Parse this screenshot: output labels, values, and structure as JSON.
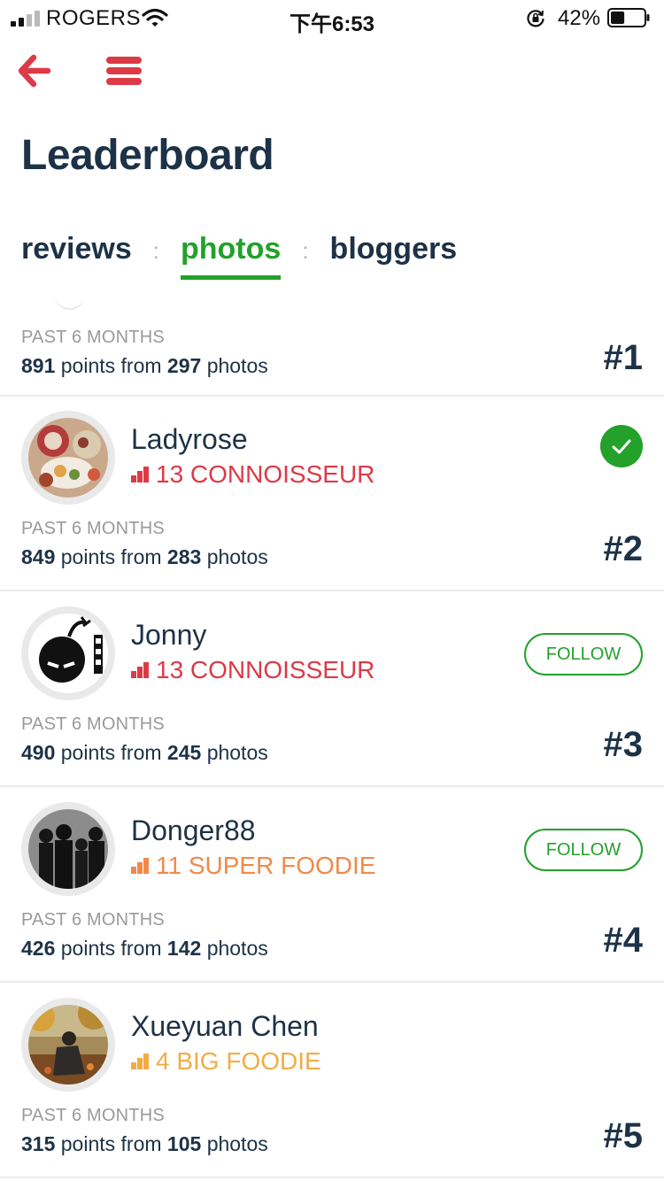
{
  "status_bar": {
    "carrier": "ROGERS",
    "time": "下午6:53",
    "battery_percent": "42%",
    "battery_level": 0.42
  },
  "nav": {
    "back_icon": "arrow-left-icon",
    "menu_icon": "hamburger-menu-icon"
  },
  "page": {
    "title": "Leaderboard"
  },
  "tabs": [
    {
      "label": "reviews",
      "active": false
    },
    {
      "label": "photos",
      "active": true
    },
    {
      "label": "bloggers",
      "active": false
    }
  ],
  "tab_separator": ":",
  "colors": {
    "accent_green": "#23a12a",
    "brand_red": "#dc3a47",
    "level_connoisseur": "#dc3a47",
    "level_super_foodie": "#ef8a4a",
    "level_big_foodie": "#f2ac45",
    "text_dark": "#1d3246",
    "text_muted": "#9a9a9a"
  },
  "entries": [
    {
      "stats": {
        "period": "PAST 6 MONTHS",
        "points": "891",
        "points_label": "points from",
        "photos": "297",
        "photos_label": "photos"
      },
      "rank": "#1"
    },
    {
      "user": {
        "name": "Ladyrose",
        "level": "13 CONNOISSEUR",
        "follow_state": "following"
      },
      "stats": {
        "period": "PAST 6 MONTHS",
        "points": "849",
        "points_label": "points from",
        "photos": "283",
        "photos_label": "photos"
      },
      "rank": "#2"
    },
    {
      "user": {
        "name": "Jonny",
        "level": "13 CONNOISSEUR",
        "follow_label": "FOLLOW"
      },
      "stats": {
        "period": "PAST 6 MONTHS",
        "points": "490",
        "points_label": "points from",
        "photos": "245",
        "photos_label": "photos"
      },
      "rank": "#3"
    },
    {
      "user": {
        "name": "Donger88",
        "level": "11 SUPER FOODIE",
        "follow_label": "FOLLOW"
      },
      "stats": {
        "period": "PAST 6 MONTHS",
        "points": "426",
        "points_label": "points from",
        "photos": "142",
        "photos_label": "photos"
      },
      "rank": "#4"
    },
    {
      "user": {
        "name": "Xueyuan Chen",
        "level": "4 BIG FOODIE"
      },
      "stats": {
        "period": "PAST 6 MONTHS",
        "points": "315",
        "points_label": "points from",
        "photos": "105",
        "photos_label": "photos"
      },
      "rank": "#5"
    }
  ]
}
